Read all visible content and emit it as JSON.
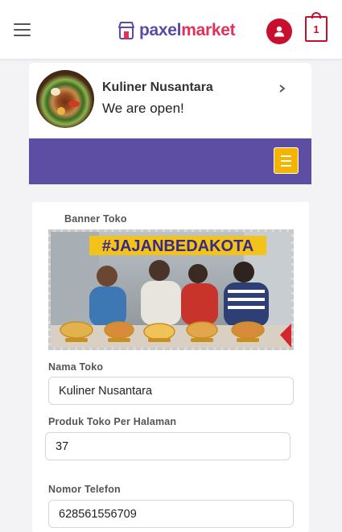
{
  "header": {
    "brand_part1": "paxel",
    "brand_part2": "market",
    "cart_count": "1",
    "colors": {
      "brand_purple": "#5b4aa6",
      "brand_pink": "#e2315a",
      "accent_red": "#c8102e"
    }
  },
  "store": {
    "name": "Kuliner Nusantara",
    "status": "We are open!",
    "band_color": "#5e4ea3",
    "menu_button_color": "#f5b400"
  },
  "form": {
    "banner_label": "Banner Toko",
    "banner_headline": "#JAJANBEDAKOTA",
    "name_label": "Nama Toko",
    "name_value": "Kuliner Nusantara",
    "per_page_label": "Produk Toko Per Halaman",
    "per_page_value": "37",
    "phone_label": "Nomor Telefon",
    "phone_value": "628561556709"
  }
}
